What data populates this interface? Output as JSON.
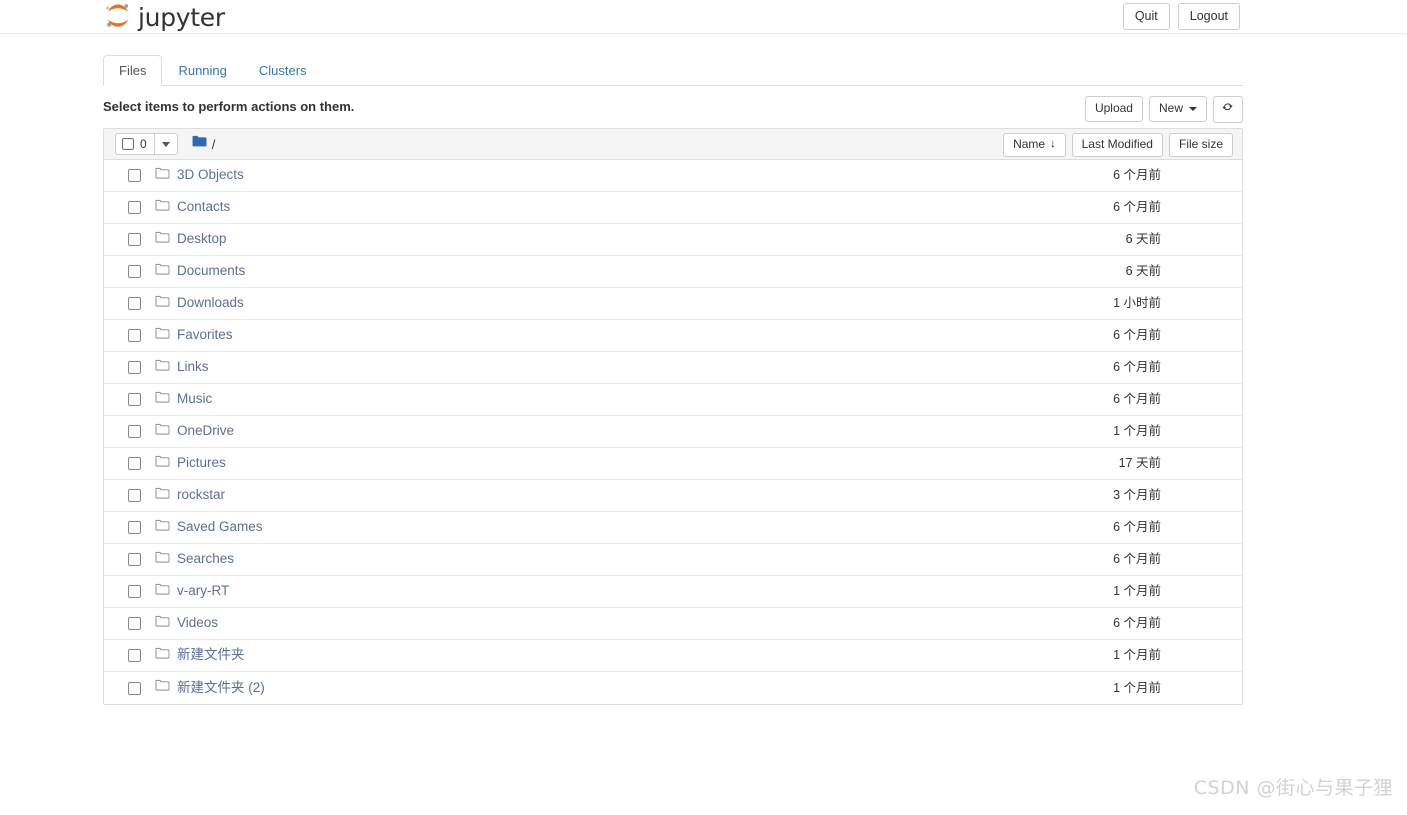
{
  "header": {
    "brand_text": "jupyter",
    "brand_logo_icon": "jupyter-logo-icon",
    "quit_label": "Quit",
    "logout_label": "Logout"
  },
  "tabs": [
    {
      "label": "Files",
      "active": true
    },
    {
      "label": "Running",
      "active": false
    },
    {
      "label": "Clusters",
      "active": false
    }
  ],
  "action_row": {
    "select_hint": "Select items to perform actions on them.",
    "upload_label": "Upload",
    "new_label": "New",
    "new_caret_icon": "chevron-down-icon",
    "refresh_icon": "refresh-icon",
    "refresh_glyph": "↻"
  },
  "list_header": {
    "selected_count": "0",
    "select_all_checkbox_icon": "checkbox-icon",
    "select_dropdown_icon": "chevron-down-icon",
    "breadcrumb_folder_icon": "folder-filled-icon",
    "breadcrumb_path": "/",
    "sort_name_label": "Name",
    "sort_name_arrow": "↓",
    "sort_name_arrow_icon": "arrow-down-icon",
    "sort_modified_label": "Last Modified",
    "sort_size_label": "File size"
  },
  "files": [
    {
      "name": "3D Objects",
      "modified": "6 个月前",
      "icon": "folder-icon"
    },
    {
      "name": "Contacts",
      "modified": "6 个月前",
      "icon": "folder-icon"
    },
    {
      "name": "Desktop",
      "modified": "6 天前",
      "icon": "folder-icon"
    },
    {
      "name": "Documents",
      "modified": "6 天前",
      "icon": "folder-icon"
    },
    {
      "name": "Downloads",
      "modified": "1 小时前",
      "icon": "folder-icon"
    },
    {
      "name": "Favorites",
      "modified": "6 个月前",
      "icon": "folder-icon"
    },
    {
      "name": "Links",
      "modified": "6 个月前",
      "icon": "folder-icon"
    },
    {
      "name": "Music",
      "modified": "6 个月前",
      "icon": "folder-icon"
    },
    {
      "name": "OneDrive",
      "modified": "1 个月前",
      "icon": "folder-icon"
    },
    {
      "name": "Pictures",
      "modified": "17 天前",
      "icon": "folder-icon"
    },
    {
      "name": "rockstar",
      "modified": "3 个月前",
      "icon": "folder-icon"
    },
    {
      "name": "Saved Games",
      "modified": "6 个月前",
      "icon": "folder-icon"
    },
    {
      "name": "Searches",
      "modified": "6 个月前",
      "icon": "folder-icon"
    },
    {
      "name": "v-ary-RT",
      "modified": "1 个月前",
      "icon": "folder-icon"
    },
    {
      "name": "Videos",
      "modified": "6 个月前",
      "icon": "folder-icon"
    },
    {
      "name": "新建文件夹",
      "modified": "1 个月前",
      "icon": "folder-icon"
    },
    {
      "name": "新建文件夹 (2)",
      "modified": "1 个月前",
      "icon": "folder-icon"
    }
  ],
  "watermark": {
    "text": "CSDN @街心与果子狸"
  },
  "colors": {
    "brand_orange": "#e8741a",
    "link_blue": "#337ab7",
    "folder_link": "#5c6f9c",
    "folder_icon_blue": "#2d6cb5",
    "border_gray": "#dddddd",
    "header_bg": "#f5f5f5",
    "watermark_gray": "#d2d2d2"
  }
}
